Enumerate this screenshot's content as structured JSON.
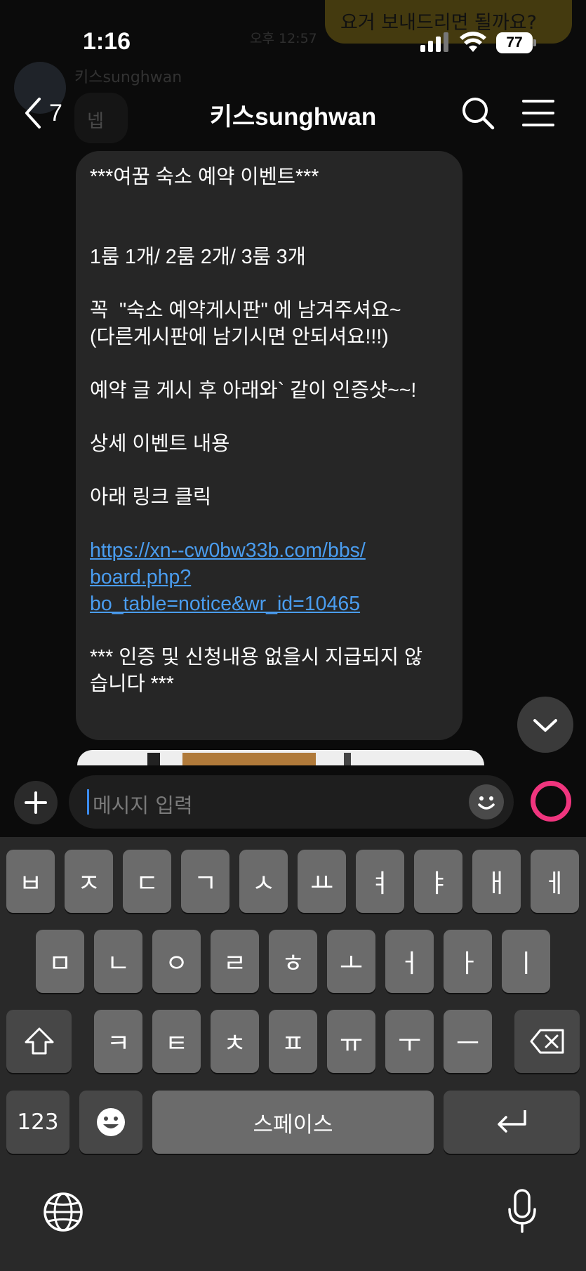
{
  "background_chat": {
    "prev_bubble_text": "요거 보내드리면 될까요?",
    "prev_time": "오후 12:57",
    "sender_name": "키스sunghwan",
    "sender_reply": "넵"
  },
  "status_bar": {
    "time": "1:16",
    "battery": "77"
  },
  "header": {
    "back_count": "7",
    "title": "키스sunghwan"
  },
  "message": {
    "lines": [
      "***여꿈 숙소 예약 이벤트***",
      "",
      "",
      "1룸 1개/ 2룸 2개/ 3룸 3개",
      "",
      "꼭  \"숙소 예약게시판\" 에 남겨주셔요~",
      "(다른게시판에 남기시면 안되셔요!!!)",
      "",
      "예약 글 게시 후 아래와` 같이 인증샷~~!",
      "",
      "상세 이벤트 내용",
      "",
      "아래 링크 클릭",
      ""
    ],
    "link_lines": [
      "https://xn--cw0bw33b.com/bbs/",
      "board.php?",
      "bo_table=notice&wr_id=10465"
    ],
    "footer_lines": [
      "",
      "*** 인증 및 신청내용 없을시 지급되지 않",
      "습니다 ***"
    ]
  },
  "input": {
    "placeholder": "메시지 입력"
  },
  "keyboard": {
    "row1": [
      "ㅂ",
      "ㅈ",
      "ㄷ",
      "ㄱ",
      "ㅅ",
      "ㅛ",
      "ㅕ",
      "ㅑ",
      "ㅐ",
      "ㅔ"
    ],
    "row2": [
      "ㅁ",
      "ㄴ",
      "ㅇ",
      "ㄹ",
      "ㅎ",
      "ㅗ",
      "ㅓ",
      "ㅏ",
      "ㅣ"
    ],
    "row3": [
      "ㅋ",
      "ㅌ",
      "ㅊ",
      "ㅍ",
      "ㅠ",
      "ㅜ",
      "ㅡ"
    ],
    "numbers_label": "123",
    "space_label": "스페이스"
  },
  "colors": {
    "background": "#0b0b0b",
    "bubble": "#262626",
    "link": "#4a9df0",
    "accent_ring": "#f0357e",
    "key": "#6b6b6b",
    "key_dark": "#474747",
    "keyboard_bg": "#292929"
  },
  "icons": [
    "signal-icon",
    "wifi-icon",
    "battery-icon",
    "back-chevron-icon",
    "search-icon",
    "menu-icon",
    "chevron-down-icon",
    "plus-icon",
    "emoji-icon",
    "ring-icon",
    "shift-icon",
    "backspace-icon",
    "emoji-keyboard-icon",
    "return-icon",
    "globe-icon",
    "microphone-icon"
  ]
}
